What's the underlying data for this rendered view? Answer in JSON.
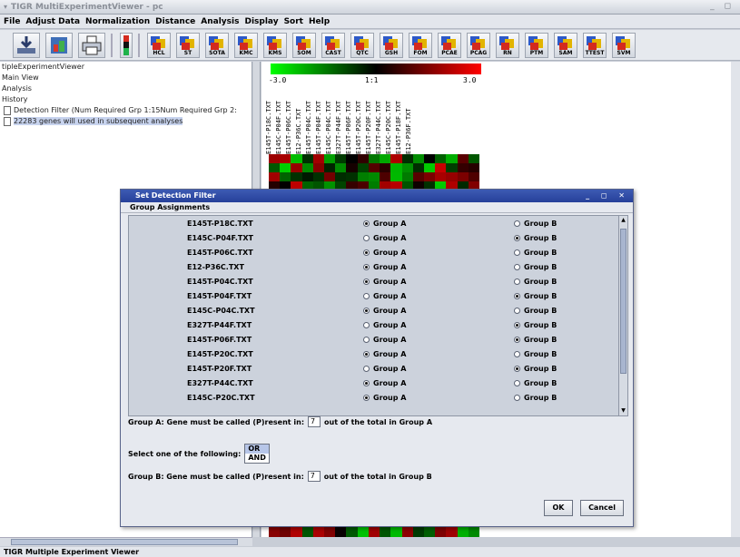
{
  "window": {
    "title": "TIGR MultiExperimentViewer - pc",
    "controls": "_ ◻"
  },
  "menu": [
    "File",
    "Adjust Data",
    "Normalization",
    "Distance",
    "Analysis",
    "Display",
    "Sort",
    "Help"
  ],
  "toolbar": {
    "icons": [
      "HCL",
      "ST",
      "SOTA",
      "KMC",
      "KMS",
      "SOM",
      "CAST",
      "QTC",
      "GSH",
      "FOM",
      "PCAE",
      "PCAG",
      "RN",
      "PTM",
      "SAM",
      "TTEST",
      "SVM"
    ]
  },
  "tree": {
    "root": "tipleExperimentViewer",
    "items": [
      "Main View",
      "Analysis",
      "History"
    ],
    "history": [
      "Detection Filter (Num Required Grp 1:15Num Required Grp 2:",
      "22283 genes will used in subsequent analyses"
    ]
  },
  "viewer": {
    "scale": [
      "-3.0",
      "1:1",
      "3.0"
    ],
    "columns": [
      "E145T-P18C.TXT",
      "E145C-P04F.TXT",
      "E145T-P06C.TXT",
      "E12-P36C.TXT",
      "E145T-P04C.TXT",
      "E145T-P04F.TXT",
      "E145C-P04C.TXT",
      "E327T-P44F.TXT",
      "E145T-P06F.TXT",
      "E145T-P20C.TXT",
      "E145T-P20F.TXT",
      "E327T-P44C.TXT",
      "E145C-P20C.TXT",
      "E145T-P18F.TXT",
      "E12-P36F.TXT"
    ]
  },
  "dialog": {
    "title": "Set Detection Filter",
    "controls": "_ ◻ ✕",
    "section": "Group Assignments",
    "rows": [
      {
        "file": "E145T-P18C.TXT",
        "group": "A"
      },
      {
        "file": "E145C-P04F.TXT",
        "group": "B"
      },
      {
        "file": "E145T-P06C.TXT",
        "group": "A"
      },
      {
        "file": "E12-P36C.TXT",
        "group": "A"
      },
      {
        "file": "E145T-P04C.TXT",
        "group": "A"
      },
      {
        "file": "E145T-P04F.TXT",
        "group": "B"
      },
      {
        "file": "E145C-P04C.TXT",
        "group": "A"
      },
      {
        "file": "E327T-P44F.TXT",
        "group": "B"
      },
      {
        "file": "E145T-P06F.TXT",
        "group": "B"
      },
      {
        "file": "E145T-P20C.TXT",
        "group": "A"
      },
      {
        "file": "E145T-P20F.TXT",
        "group": "B"
      },
      {
        "file": "E327T-P44C.TXT",
        "group": "A"
      },
      {
        "file": "E145C-P20C.TXT",
        "group": "A"
      }
    ],
    "group_a_label": "Group A",
    "group_b_label": "Group B",
    "line_a_prefix": "Group A: Gene must be called (P)resent in:",
    "line_a_value": "7",
    "line_a_suffix": "out of the total in Group A",
    "select_label": "Select one of the following:",
    "options": [
      "OR",
      "AND"
    ],
    "line_b_prefix": "Group B: Gene must be called (P)resent in:",
    "line_b_value": "7",
    "line_b_suffix": "out of the total in Group B",
    "ok": "OK",
    "cancel": "Cancel"
  },
  "status": "TIGR Multiple Experiment Viewer"
}
